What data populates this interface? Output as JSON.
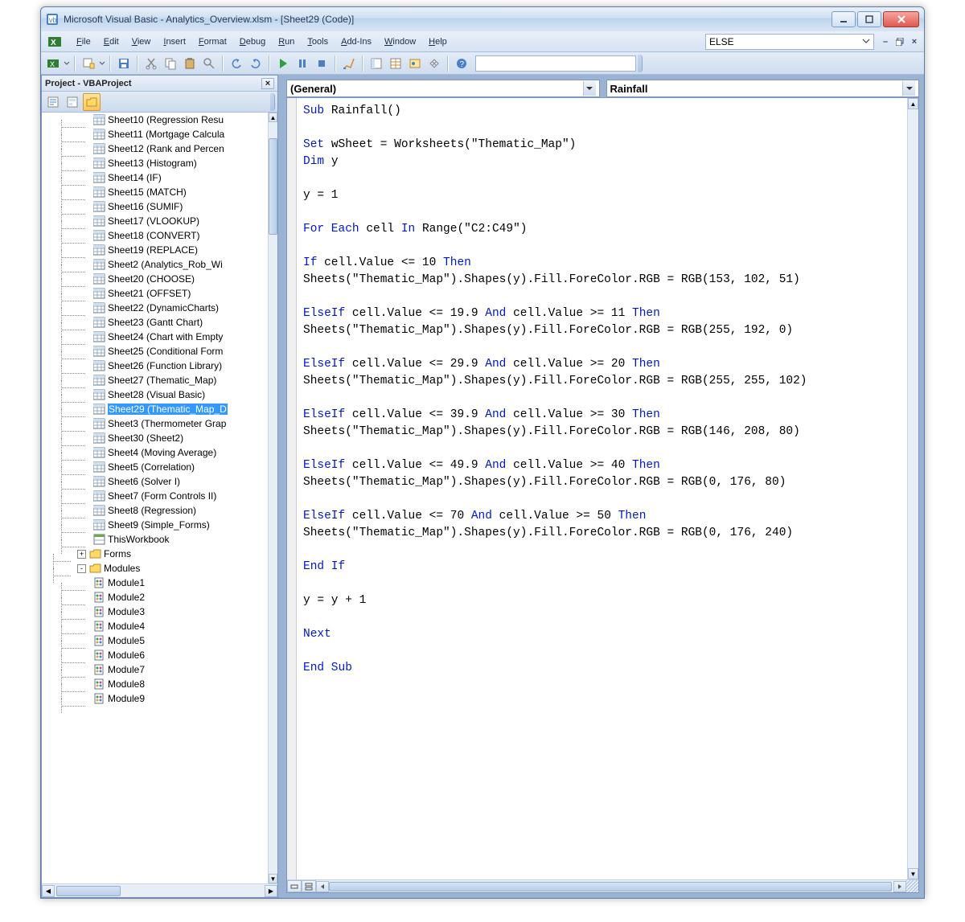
{
  "titlebar": {
    "text": "Microsoft Visual Basic - Analytics_Overview.xlsm - [Sheet29 (Code)]"
  },
  "menu": {
    "items": [
      "File",
      "Edit",
      "View",
      "Insert",
      "Format",
      "Debug",
      "Run",
      "Tools",
      "Add-Ins",
      "Window",
      "Help"
    ],
    "scope_value": "ELSE"
  },
  "project": {
    "pane_title": "Project - VBAProject",
    "sheets": [
      "Sheet10 (Regression Resu",
      "Sheet11 (Mortgage Calcula",
      "Sheet12 (Rank and Percen",
      "Sheet13 (Histogram)",
      "Sheet14 (IF)",
      "Sheet15 (MATCH)",
      "Sheet16 (SUMIF)",
      "Sheet17 (VLOOKUP)",
      "Sheet18 (CONVERT)",
      "Sheet19 (REPLACE)",
      "Sheet2 (Analytics_Rob_Wi",
      "Sheet20 (CHOOSE)",
      "Sheet21 (OFFSET)",
      "Sheet22 (DynamicCharts)",
      "Sheet23 (Gantt Chart)",
      "Sheet24 (Chart with Empty",
      "Sheet25 (Conditional Form",
      "Sheet26 (Function Library)",
      "Sheet27 (Thematic_Map)",
      "Sheet28 (Visual Basic)",
      "Sheet29 (Thematic_Map_D",
      "Sheet3 (Thermometer Grap",
      "Sheet30 (Sheet2)",
      "Sheet4 (Moving Average)",
      "Sheet5 (Correlation)",
      "Sheet6 (Solver I)",
      "Sheet7 (Form Controls II)",
      "Sheet8 (Regression)",
      "Sheet9 (Simple_Forms)"
    ],
    "workbook": "ThisWorkbook",
    "folders": [
      {
        "name": "Forms",
        "exp": "+"
      },
      {
        "name": "Modules",
        "exp": "-"
      }
    ],
    "modules": [
      "Module1",
      "Module2",
      "Module3",
      "Module4",
      "Module5",
      "Module6",
      "Module7",
      "Module8",
      "Module9"
    ],
    "selected_index": 20
  },
  "code": {
    "object_dd": "(General)",
    "proc_dd": "Rainfall",
    "lines": [
      {
        "segs": [
          {
            "t": "Sub ",
            "k": 1
          },
          {
            "t": "Rainfall()"
          }
        ]
      },
      {
        "segs": []
      },
      {
        "segs": [
          {
            "t": "Set ",
            "k": 1
          },
          {
            "t": "wSheet = Worksheets(\"Thematic_Map\")"
          }
        ]
      },
      {
        "segs": [
          {
            "t": "Dim ",
            "k": 1
          },
          {
            "t": "y"
          }
        ]
      },
      {
        "segs": []
      },
      {
        "segs": [
          {
            "t": "y = 1"
          }
        ]
      },
      {
        "segs": []
      },
      {
        "segs": [
          {
            "t": "For Each ",
            "k": 1
          },
          {
            "t": "cell "
          },
          {
            "t": "In ",
            "k": 1
          },
          {
            "t": "Range(\"C2:C49\")"
          }
        ]
      },
      {
        "segs": []
      },
      {
        "segs": [
          {
            "t": "If ",
            "k": 1
          },
          {
            "t": "cell.Value <= 10 "
          },
          {
            "t": "Then",
            "k": 1
          }
        ]
      },
      {
        "segs": [
          {
            "t": "Sheets(\"Thematic_Map\").Shapes(y).Fill.ForeColor.RGB = RGB(153, 102, 51)"
          }
        ]
      },
      {
        "segs": []
      },
      {
        "segs": [
          {
            "t": "ElseIf ",
            "k": 1
          },
          {
            "t": "cell.Value <= 19.9 "
          },
          {
            "t": "And ",
            "k": 1
          },
          {
            "t": "cell.Value >= 11 "
          },
          {
            "t": "Then",
            "k": 1
          }
        ]
      },
      {
        "segs": [
          {
            "t": "Sheets(\"Thematic_Map\").Shapes(y).Fill.ForeColor.RGB = RGB(255, 192, 0)"
          }
        ]
      },
      {
        "segs": []
      },
      {
        "segs": [
          {
            "t": "ElseIf ",
            "k": 1
          },
          {
            "t": "cell.Value <= 29.9 "
          },
          {
            "t": "And ",
            "k": 1
          },
          {
            "t": "cell.Value >= 20 "
          },
          {
            "t": "Then",
            "k": 1
          }
        ]
      },
      {
        "segs": [
          {
            "t": "Sheets(\"Thematic_Map\").Shapes(y).Fill.ForeColor.RGB = RGB(255, 255, 102)"
          }
        ]
      },
      {
        "segs": []
      },
      {
        "segs": [
          {
            "t": "ElseIf ",
            "k": 1
          },
          {
            "t": "cell.Value <= 39.9 "
          },
          {
            "t": "And ",
            "k": 1
          },
          {
            "t": "cell.Value >= 30 "
          },
          {
            "t": "Then",
            "k": 1
          }
        ]
      },
      {
        "segs": [
          {
            "t": "Sheets(\"Thematic_Map\").Shapes(y).Fill.ForeColor.RGB = RGB(146, 208, 80)"
          }
        ]
      },
      {
        "segs": []
      },
      {
        "segs": [
          {
            "t": "ElseIf ",
            "k": 1
          },
          {
            "t": "cell.Value <= 49.9 "
          },
          {
            "t": "And ",
            "k": 1
          },
          {
            "t": "cell.Value >= 40 "
          },
          {
            "t": "Then",
            "k": 1
          }
        ]
      },
      {
        "segs": [
          {
            "t": "Sheets(\"Thematic_Map\").Shapes(y).Fill.ForeColor.RGB = RGB(0, 176, 80)"
          }
        ]
      },
      {
        "segs": []
      },
      {
        "segs": [
          {
            "t": "ElseIf ",
            "k": 1
          },
          {
            "t": "cell.Value <= 70 "
          },
          {
            "t": "And ",
            "k": 1
          },
          {
            "t": "cell.Value >= 50 "
          },
          {
            "t": "Then",
            "k": 1
          }
        ]
      },
      {
        "segs": [
          {
            "t": "Sheets(\"Thematic_Map\").Shapes(y).Fill.ForeColor.RGB = RGB(0, 176, 240)"
          }
        ]
      },
      {
        "segs": []
      },
      {
        "segs": [
          {
            "t": "End If",
            "k": 1
          }
        ]
      },
      {
        "segs": []
      },
      {
        "segs": [
          {
            "t": "y = y + 1"
          }
        ]
      },
      {
        "segs": []
      },
      {
        "segs": [
          {
            "t": "Next",
            "k": 1
          }
        ]
      },
      {
        "segs": []
      },
      {
        "segs": [
          {
            "t": "End Sub",
            "k": 1
          }
        ]
      }
    ]
  }
}
